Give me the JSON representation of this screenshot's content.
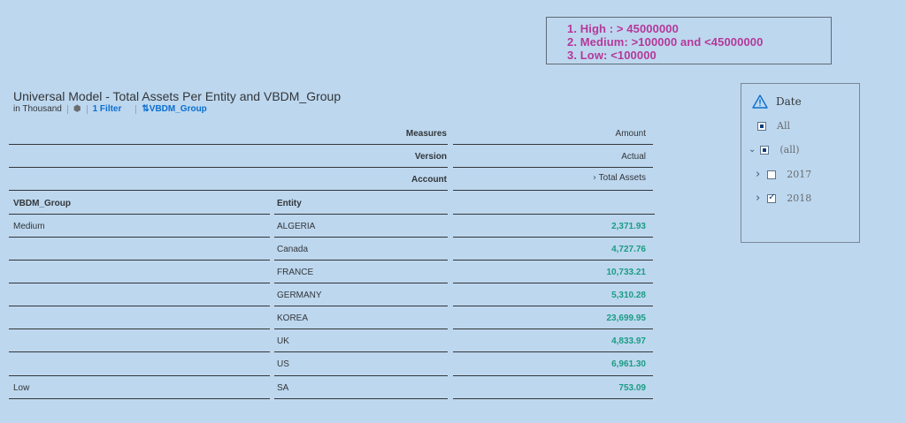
{
  "legend": {
    "items": [
      "1. High : > 45000000",
      "2. Medium: >100000 and <45000000",
      "3. Low: <100000"
    ]
  },
  "table": {
    "title": "Universal Model - Total Assets Per Entity and VBDM_Group",
    "unit": "in Thousand",
    "filter_label": "1 Filter",
    "sort_label": "VBDM_Group",
    "header_labels": {
      "measures": "Measures",
      "version": "Version",
      "account": "Account"
    },
    "header_values": {
      "measures": "Amount",
      "version": "Actual",
      "account": "Total Assets"
    },
    "columns": {
      "group": "VBDM_Group",
      "entity": "Entity"
    },
    "rows": [
      {
        "group": "Medium",
        "entity": "ALGERIA",
        "value": "2,371.93"
      },
      {
        "group": "",
        "entity": "Canada",
        "value": "4,727.76"
      },
      {
        "group": "",
        "entity": "FRANCE",
        "value": "10,733.21"
      },
      {
        "group": "",
        "entity": "GERMANY",
        "value": "5,310.28"
      },
      {
        "group": "",
        "entity": "KOREA",
        "value": "23,699.95"
      },
      {
        "group": "",
        "entity": "UK",
        "value": "4,833.97"
      },
      {
        "group": "",
        "entity": "US",
        "value": "6,961.30"
      },
      {
        "group": "Low",
        "entity": "SA",
        "value": "753.09"
      }
    ],
    "value_color": "#1a9c84"
  },
  "filter_panel": {
    "title": "Date",
    "all_label": "All",
    "all_node": "(all)",
    "years": [
      {
        "label": "2017",
        "checked": false
      },
      {
        "label": "2018",
        "checked": true
      }
    ]
  }
}
